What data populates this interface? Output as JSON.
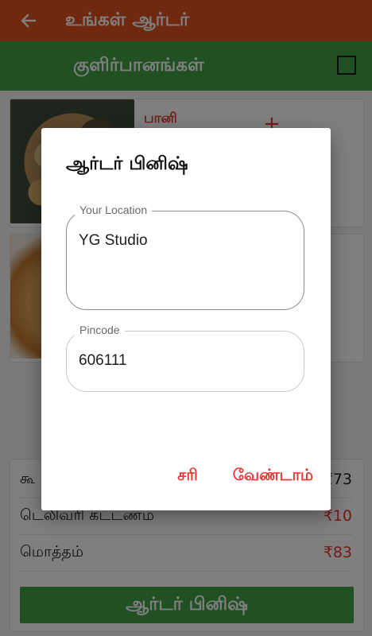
{
  "appbar": {
    "title": "உங்கள் ஆர்டர்"
  },
  "category": {
    "title": "குளிர்பானங்கள்"
  },
  "products": [
    {
      "name": "பானி",
      "add_label": "+"
    },
    {
      "name": ""
    }
  ],
  "summary": {
    "subtotal_label": "கூ",
    "subtotal_value": "₹73",
    "delivery_label": "டெலிவரி கட்டணம்",
    "delivery_value": "₹10",
    "total_label": "மொத்தம்",
    "total_value": "₹83",
    "finish_label": "ஆர்டர் பினிஷ்"
  },
  "dialog": {
    "title": "ஆர்டர் பினிஷ்",
    "location_label": "Your Location",
    "location_value": "YG Studio",
    "pincode_label": "Pincode",
    "pincode_value": "606111",
    "ok_label": "சரி",
    "cancel_label": "வேண்டாம்"
  },
  "colors": {
    "appbar": "#e0531f",
    "green": "#43a047",
    "accent_red": "#e53935"
  }
}
